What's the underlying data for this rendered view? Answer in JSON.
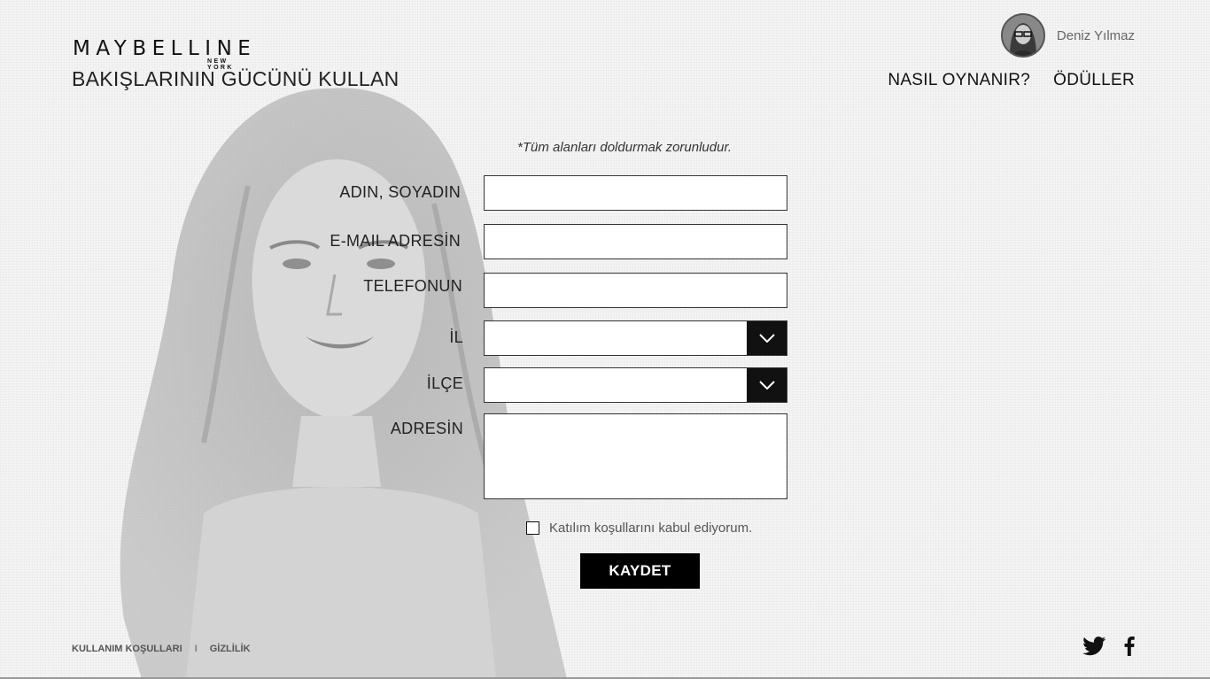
{
  "brand": {
    "logo": "MAYBELLINE",
    "logo_sub": "NEW YORK",
    "tagline": "BAKIŞLARININ GÜCÜNÜ KULLAN"
  },
  "user": {
    "name": "Deniz Yılmaz"
  },
  "nav": [
    {
      "label": "NASIL OYNANIR?"
    },
    {
      "label": "ÖDÜLLER"
    }
  ],
  "form": {
    "required_note": "*Tüm alanları doldurmak zorunludur.",
    "fields": {
      "name": {
        "label": "ADIN, SOYADIN",
        "value": ""
      },
      "email": {
        "label": "E-MAIL ADRESİN",
        "value": ""
      },
      "phone": {
        "label": "TELEFONUN",
        "value": ""
      },
      "city": {
        "label": "İL",
        "value": ""
      },
      "district": {
        "label": "İLÇE",
        "value": ""
      },
      "address": {
        "label": "ADRESİN",
        "value": ""
      }
    },
    "consent": {
      "text": "Katılım koşullarını kabul ediyorum.",
      "checked": false
    },
    "submit_label": "KAYDET"
  },
  "footer": {
    "terms": "KULLANIM KOŞULLARI",
    "separator": "I",
    "privacy": "GİZLİLİK"
  },
  "social": [
    {
      "icon": "twitter-icon"
    },
    {
      "icon": "facebook-icon"
    }
  ],
  "colors": {
    "accent": "#000000",
    "background": "#f4f4f4",
    "text": "#111111"
  }
}
